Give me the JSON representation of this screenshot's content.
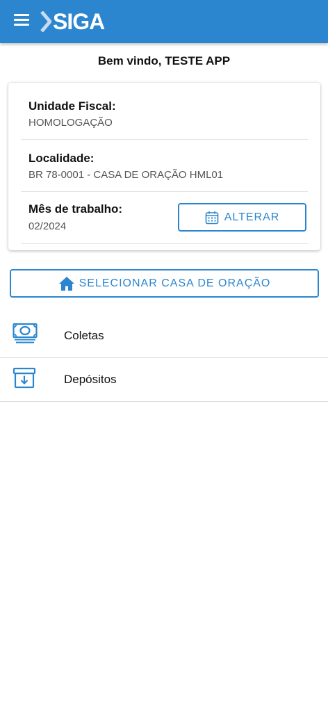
{
  "app": {
    "logo_text": "SIGA"
  },
  "welcome": "Bem vindo, TESTE APP",
  "card": {
    "unidade_label": "Unidade Fiscal:",
    "unidade_value": "HOMOLOGAÇÃO",
    "localidade_label": "Localidade:",
    "localidade_value": "BR 78-0001 - CASA DE ORAÇÃO HML01",
    "mes_label": "Mês de trabalho:",
    "mes_value": "02/2024",
    "alterar_label": "ALTERAR"
  },
  "select_button_label": "SELECIONAR CASA DE ORAÇÃO",
  "menu_items": [
    {
      "label": "Coletas",
      "icon": "money-icon"
    },
    {
      "label": "Depósitos",
      "icon": "archive-download-icon"
    }
  ],
  "colors": {
    "primary": "#2b86cf",
    "text": "#111111",
    "muted": "#555555"
  }
}
